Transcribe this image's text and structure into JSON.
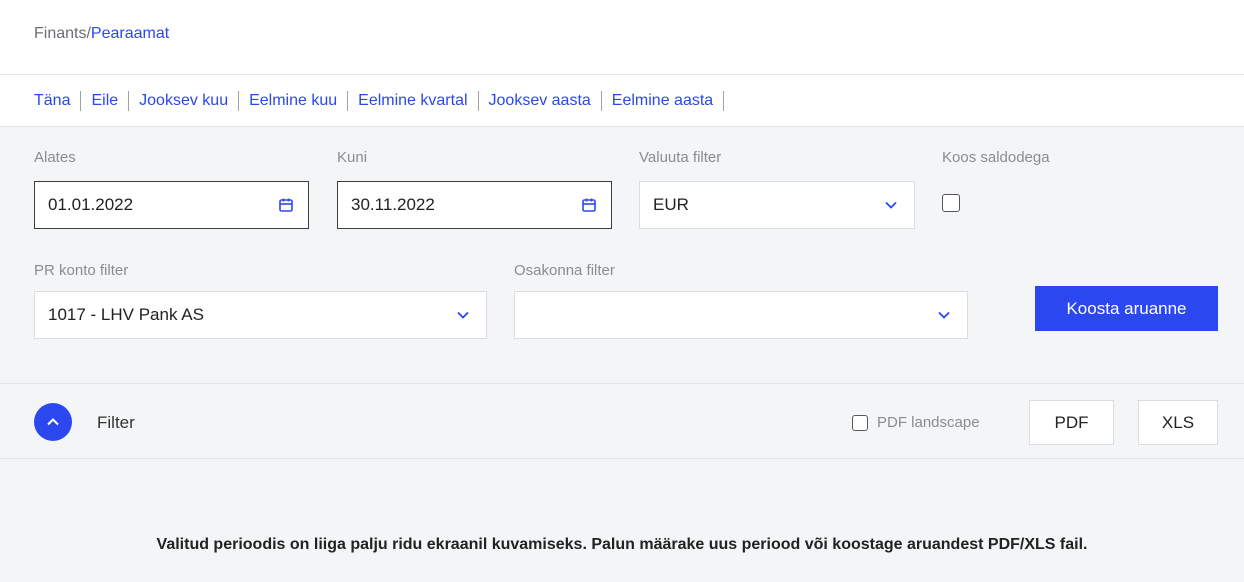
{
  "breadcrumb": {
    "root": "Finants",
    "separator": "/",
    "current": "Pearaamat"
  },
  "periods": [
    "Täna",
    "Eile",
    "Jooksev kuu",
    "Eelmine kuu",
    "Eelmine kvartal",
    "Jooksev aasta",
    "Eelmine aasta"
  ],
  "filters": {
    "from_label": "Alates",
    "from_value": "01.01.2022",
    "to_label": "Kuni",
    "to_value": "30.11.2022",
    "currency_label": "Valuuta filter",
    "currency_value": "EUR",
    "balances_label": "Koos saldodega",
    "account_label": "PR konto filter",
    "account_value": "1017 - LHV Pank AS",
    "department_label": "Osakonna filter",
    "department_value": "",
    "submit_label": "Koosta aruanne"
  },
  "toolbar": {
    "filter_label": "Filter",
    "pdf_landscape_label": "PDF landscape",
    "pdf_button": "PDF",
    "xls_button": "XLS"
  },
  "message": "Valitud perioodis on liiga palju ridu ekraanil kuvamiseks. Palun määrake uus periood või koostage aruandest PDF/XLS fail.",
  "colors": {
    "accent": "#2b47f0",
    "background": "#f4f5f7"
  },
  "icons": {
    "date": "calendar-icon",
    "select": "chevron-down-icon",
    "toggle": "chevron-up-icon"
  }
}
